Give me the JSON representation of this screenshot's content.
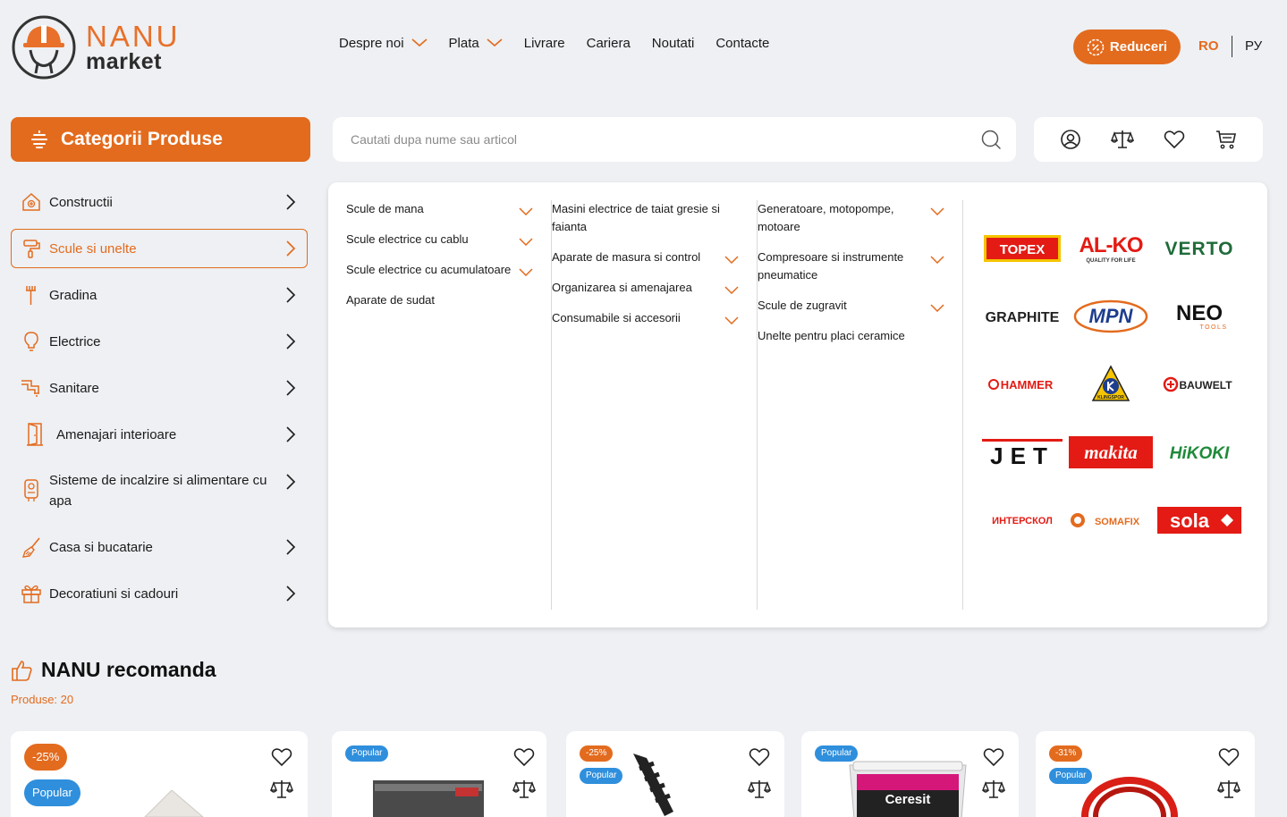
{
  "header": {
    "logo": {
      "brand": "NANU",
      "sub": "market"
    },
    "nav": [
      {
        "label": "Despre noi",
        "dropdown": true
      },
      {
        "label": "Plata",
        "dropdown": true
      },
      {
        "label": "Livrare",
        "dropdown": false
      },
      {
        "label": "Cariera",
        "dropdown": false
      },
      {
        "label": "Noutati",
        "dropdown": false
      },
      {
        "label": "Contacte",
        "dropdown": false
      }
    ],
    "discounts_label": "Reduceri",
    "lang_active": "RO",
    "lang_other": "РУ"
  },
  "categories_button": "Categorii Produse",
  "search": {
    "placeholder": "Cautati dupa nume sau articol"
  },
  "actions": [
    "user-icon",
    "compare-icon",
    "heart-icon",
    "cart-icon"
  ],
  "sidebar": {
    "items": [
      {
        "label": "Constructii",
        "icon": "house-icon"
      },
      {
        "label": "Scule si unelte",
        "icon": "paint-roller-icon",
        "active": true
      },
      {
        "label": "Gradina",
        "icon": "rake-icon"
      },
      {
        "label": "Electrice",
        "icon": "lightbulb-icon"
      },
      {
        "label": "Sanitare",
        "icon": "pipe-icon"
      },
      {
        "label": "Amenajari interioare",
        "icon": "door-icon"
      },
      {
        "label": "Sisteme de incalzire si alimentare cu apa",
        "icon": "boiler-icon"
      },
      {
        "label": "Casa si bucatarie",
        "icon": "broom-icon"
      },
      {
        "label": "Decoratiuni si cadouri",
        "icon": "gift-icon"
      }
    ]
  },
  "mega_menu": {
    "columns": [
      [
        {
          "label": "Scule de mana",
          "expandable": true
        },
        {
          "label": "Scule electrice cu cablu",
          "expandable": true
        },
        {
          "label": "Scule electrice cu acumulatoare",
          "expandable": true
        },
        {
          "label": "Aparate de sudat",
          "expandable": false
        }
      ],
      [
        {
          "label": "Masini electrice de taiat gresie si faianta",
          "expandable": false
        },
        {
          "label": "Aparate de masura si control",
          "expandable": true
        },
        {
          "label": "Organizarea si amenajarea",
          "expandable": true
        },
        {
          "label": "Consumabile si accesorii",
          "expandable": true
        }
      ],
      [
        {
          "label": "Generatoare, motopompe, motoare",
          "expandable": true
        },
        {
          "label": "Compresoare si instrumente pneumatice",
          "expandable": true
        },
        {
          "label": "Scule de zugravit",
          "expandable": true
        },
        {
          "label": "Unelte pentru placi ceramice",
          "expandable": false
        }
      ]
    ],
    "brands": [
      "TOPEX",
      "AL-KO",
      "VERTO",
      "GRAPHITE",
      "MPN",
      "NEO",
      "HAMMER",
      "KLINGSPOR",
      "BAUWELT",
      "JET",
      "makita",
      "HiKOKI",
      "ИНТЕРСКОЛ",
      "SOMAFIX",
      "sola"
    ],
    "brand_taglines": {
      "alko": "QUALITY FOR LIFE",
      "neo": "TOOLS"
    }
  },
  "recommend": {
    "title": "NANU recomanda",
    "count": "Produse: 20",
    "cards": [
      {
        "badges": [
          {
            "text": "-25%",
            "type": "disc"
          },
          {
            "text": "Popular",
            "type": "pop"
          }
        ]
      },
      {
        "badges": [
          {
            "text": "Popular",
            "type": "pop"
          }
        ]
      },
      {
        "badges": [
          {
            "text": "-25%",
            "type": "disc"
          },
          {
            "text": "Popular",
            "type": "pop"
          }
        ]
      },
      {
        "badges": [
          {
            "text": "Popular",
            "type": "pop"
          }
        ],
        "product_label": "Ceresit"
      },
      {
        "badges": [
          {
            "text": "-31%",
            "type": "disc"
          },
          {
            "text": "Popular",
            "type": "pop"
          }
        ]
      }
    ]
  },
  "colors": {
    "accent": "#e36b1e",
    "popular": "#2f8fdc",
    "background": "#eef0f3"
  }
}
